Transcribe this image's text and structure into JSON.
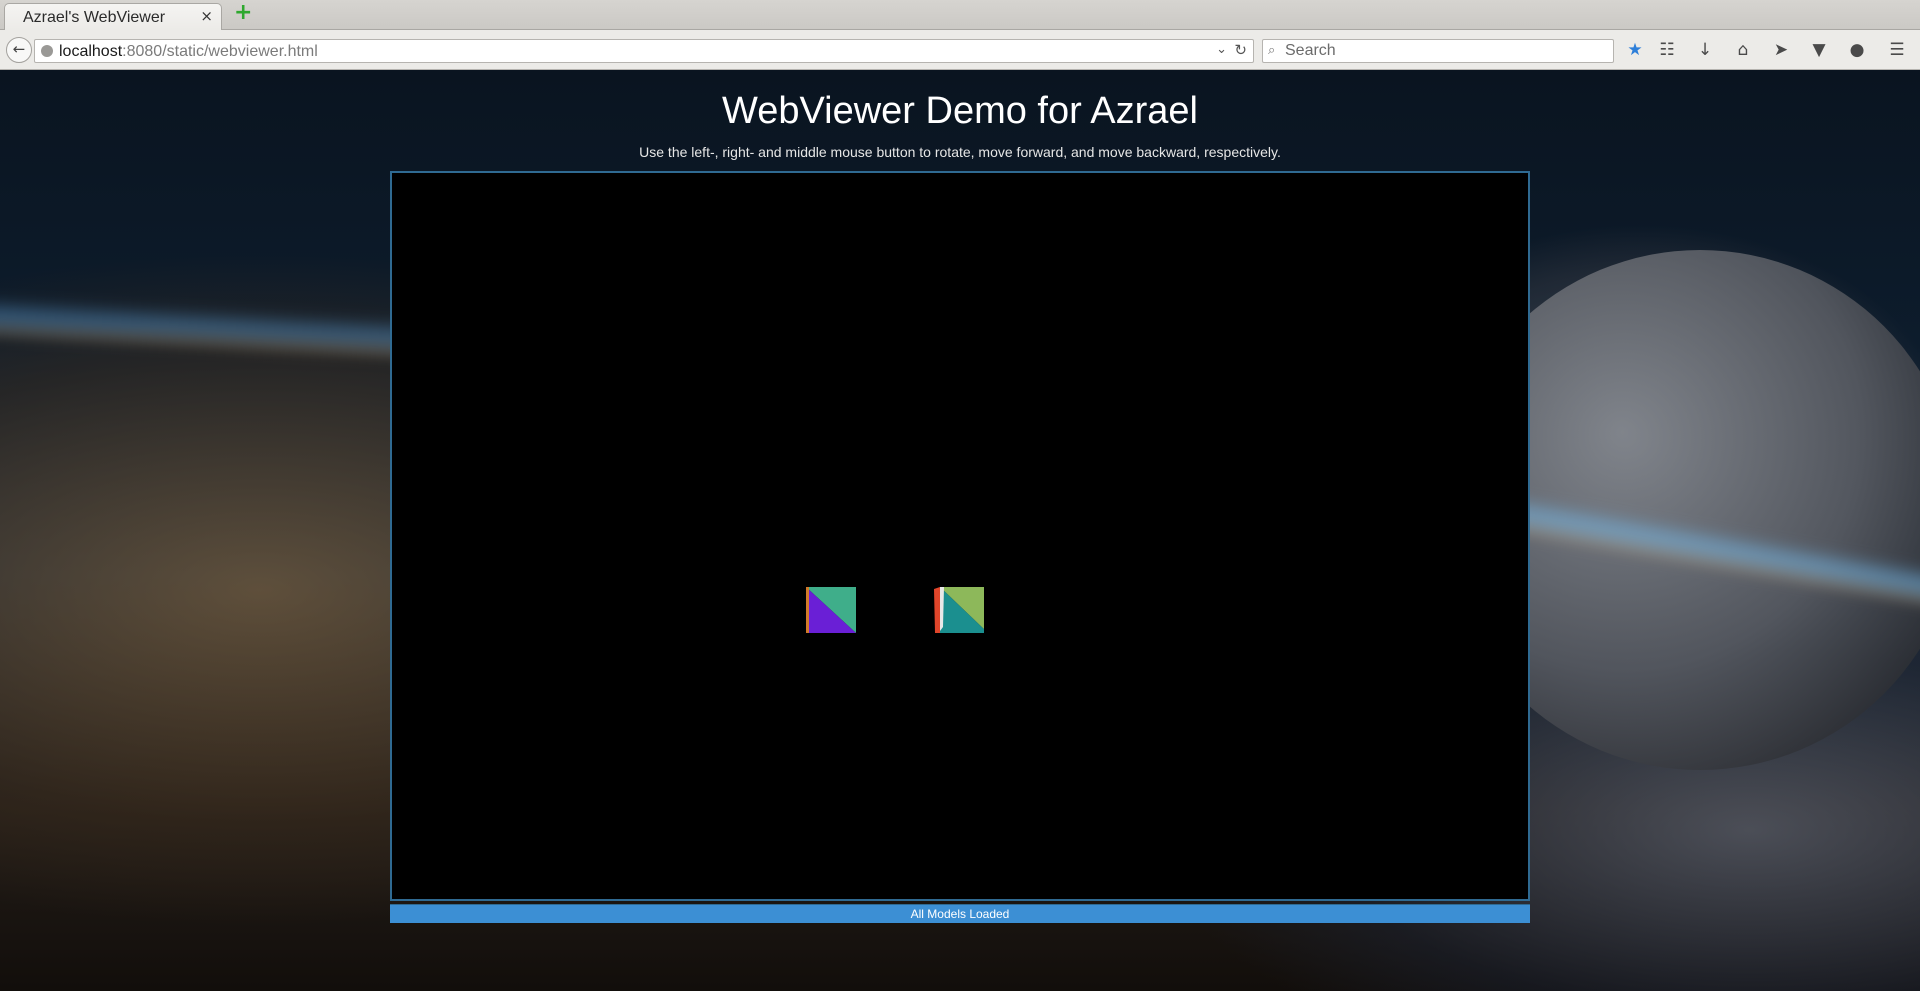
{
  "browser": {
    "tab_title": "Azrael's WebViewer",
    "tab_close_icon": "×",
    "new_tab_icon": "+",
    "url_host": "localhost",
    "url_rest": ":8080/static/webviewer.html",
    "search_placeholder": "Search",
    "toolbar_icons": [
      "bookmark-star-icon",
      "reading-list-icon",
      "downloads-icon",
      "home-icon",
      "send-icon",
      "pocket-icon",
      "chat-icon",
      "menu-icon"
    ]
  },
  "page": {
    "title": "WebViewer Demo for Azrael",
    "instructions": "Use the left-, right- and middle mouse button to rotate, move forward, and move backward, respectively.",
    "status": "All Models Loaded"
  },
  "colors": {
    "status_bar": "#3c8fd4",
    "viewer_border": "#2f6a92",
    "cube1": [
      "#3fae8a",
      "#6a1fd6",
      "#d27a2a"
    ],
    "cube2": [
      "#8db85a",
      "#1b8f8f",
      "#e0452a",
      "#e8e8e8"
    ]
  }
}
